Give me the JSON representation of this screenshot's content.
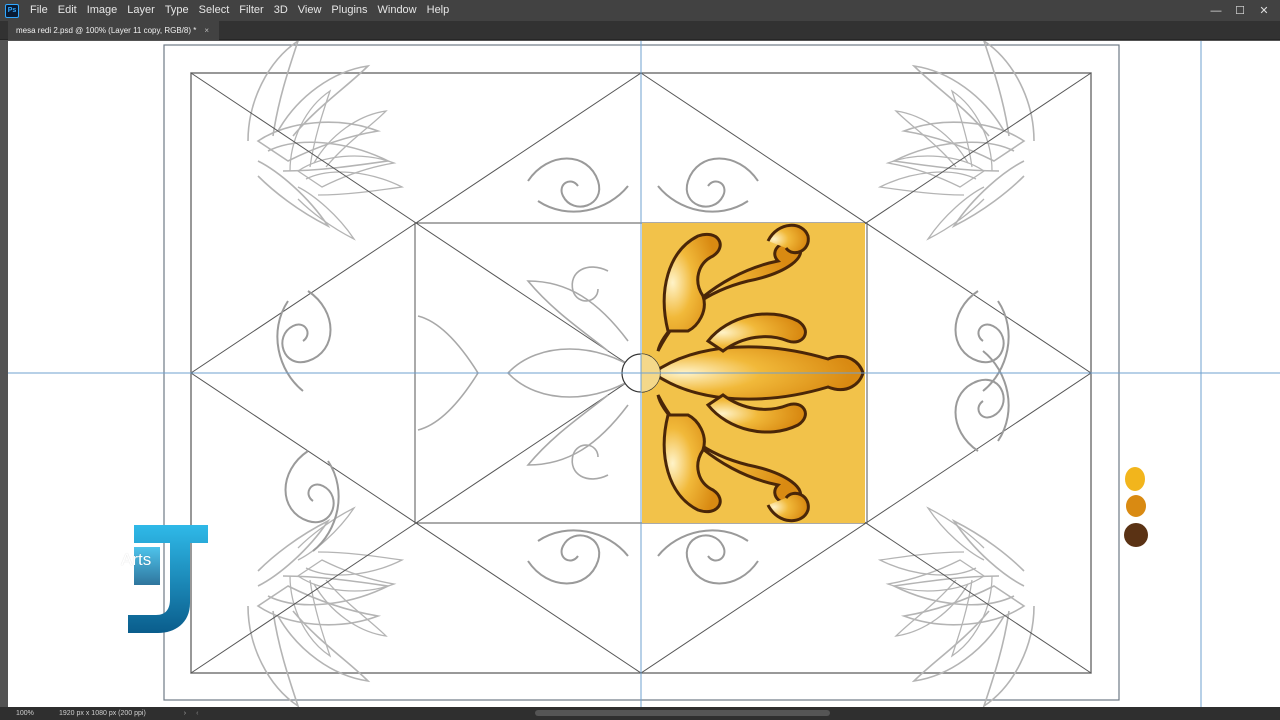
{
  "app": {
    "logo_text": "Ps",
    "menu": [
      "File",
      "Edit",
      "Image",
      "Layer",
      "Type",
      "Select",
      "Filter",
      "3D",
      "View",
      "Plugins",
      "Window",
      "Help"
    ]
  },
  "document_tab": {
    "title": "mesa redi 2.psd @ 100% (Layer 11 copy, RGB/8) *",
    "close": "×"
  },
  "window_controls": {
    "minimize": "—",
    "maximize": "☐",
    "close": "✕"
  },
  "status": {
    "zoom": "100%",
    "document_size": "1920 px x 1080 px (200 ppi)",
    "arrow": "›",
    "scroll_arrow": "‹"
  },
  "palette": {
    "swatches": [
      "#f2b51c",
      "#d98a12",
      "#5a3214"
    ]
  },
  "colors": {
    "accent_fill": "#f2c24a",
    "ornament_gold": "#e9a520",
    "ornament_outline": "#4a2608",
    "guide_blue": "#6fa0cf",
    "sketch_gray": "#8c8c8c",
    "ps_blue": "#31a8ff"
  },
  "watermark": {
    "text": "Arts"
  }
}
